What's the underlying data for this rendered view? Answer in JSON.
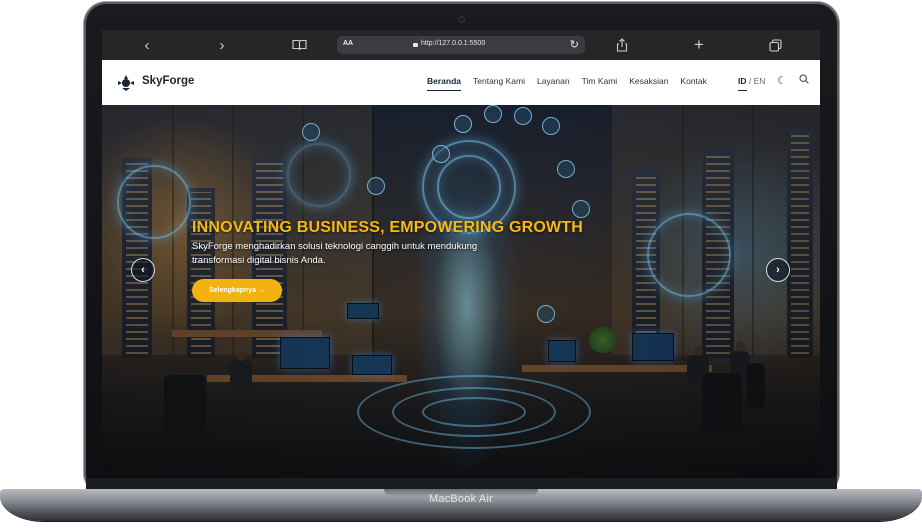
{
  "browser": {
    "back_icon": "chevron-left-icon",
    "forward_icon": "chevron-right-icon",
    "reader_label": "AA",
    "url": "http://127.0.0.1:5500"
  },
  "site": {
    "brand": "SkyForge",
    "nav": [
      {
        "label": "Beranda",
        "active": true
      },
      {
        "label": "Tentang Kami"
      },
      {
        "label": "Layanan"
      },
      {
        "label": "Tim Kami"
      },
      {
        "label": "Kesaksian"
      },
      {
        "label": "Kontak"
      }
    ],
    "lang_active": "ID",
    "lang_sep": "/",
    "lang_other": "EN"
  },
  "hero": {
    "title": "INNOVATING BUSINESS, EMPOWERING GROWTH",
    "subtitle": "SkyForge menghadirkan solusi teknologi canggih untuk mendukung transformasi digital bisnis Anda.",
    "cta": "Selengkapnya →"
  },
  "device": {
    "label": "MacBook Air"
  },
  "colors": {
    "accent": "#f2b30f",
    "nav_text": "#17263a"
  }
}
